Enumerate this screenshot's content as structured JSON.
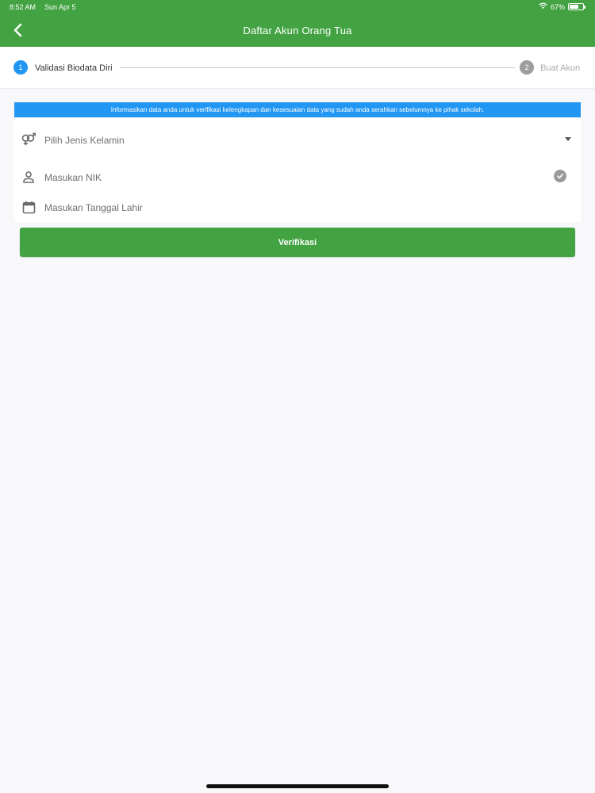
{
  "status_bar": {
    "time": "8:52 AM",
    "date": "Sun Apr 5",
    "battery_percent": "67%",
    "battery_level": 0.67,
    "icons": [
      "wifi-icon",
      "battery-icon"
    ]
  },
  "header": {
    "title": "Daftar Akun Orang Tua",
    "back_icon": "chevron-left-icon",
    "color": "#43a343"
  },
  "stepper": {
    "steps": [
      {
        "number": "1",
        "label": "Validasi Biodata Diri",
        "active": true,
        "color": "#2196f3"
      },
      {
        "number": "2",
        "label": "Buat Akun",
        "active": false,
        "color": "#9e9e9e"
      }
    ]
  },
  "info_banner": {
    "text": "Informasikan data anda untuk verifikasi kelengkapan dan kesesuaian data yang sudah anda serahkan sebelumnya ke pihak sekolah.",
    "color": "#2196f3"
  },
  "form": {
    "gender": {
      "placeholder": "Pilih Jenis Kelamin",
      "icon": "gender-icon",
      "trailing_icon": "dropdown-caret-icon"
    },
    "nik": {
      "placeholder": "Masukan NIK",
      "icon": "person-icon",
      "trailing_icon": "check-circle-icon"
    },
    "dob": {
      "placeholder": "Masukan Tanggal Lahir",
      "icon": "calendar-icon"
    }
  },
  "verify_button": {
    "label": "Verifikasi",
    "color": "#43a343"
  }
}
